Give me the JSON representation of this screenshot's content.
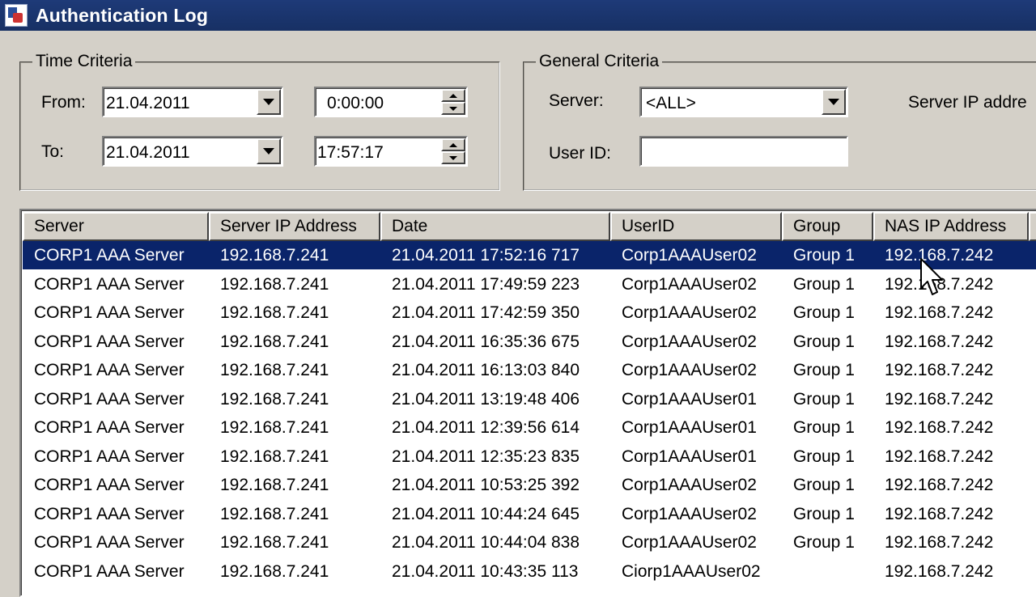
{
  "window": {
    "title": "Authentication Log"
  },
  "time_criteria": {
    "legend": "Time Criteria",
    "from_label": "From:",
    "from_date": "21.04.2011",
    "from_time": "0:00:00",
    "to_label": "To:",
    "to_date": "21.04.2011",
    "to_time": "17:57:17"
  },
  "general_criteria": {
    "legend": "General Criteria",
    "server_label": "Server:",
    "server_value": "<ALL>",
    "userid_label": "User ID:",
    "userid_value": "",
    "server_ip_label": "Server IP addre"
  },
  "table": {
    "columns": [
      "Server",
      "Server IP Address",
      "Date",
      "UserID",
      "Group",
      "NAS IP Address"
    ],
    "selected_row": 0,
    "rows": [
      [
        "CORP1 AAA Server",
        "192.168.7.241",
        "21.04.2011 17:52:16 717",
        "Corp1AAAUser02",
        "Group 1",
        "192.168.7.242"
      ],
      [
        "CORP1 AAA Server",
        "192.168.7.241",
        "21.04.2011 17:49:59 223",
        "Corp1AAAUser02",
        "Group 1",
        "192.168.7.242"
      ],
      [
        "CORP1 AAA Server",
        "192.168.7.241",
        "21.04.2011 17:42:59 350",
        "Corp1AAAUser02",
        "Group 1",
        "192.168.7.242"
      ],
      [
        "CORP1 AAA Server",
        "192.168.7.241",
        "21.04.2011 16:35:36 675",
        "Corp1AAAUser02",
        "Group 1",
        "192.168.7.242"
      ],
      [
        "CORP1 AAA Server",
        "192.168.7.241",
        "21.04.2011 16:13:03 840",
        "Corp1AAAUser02",
        "Group 1",
        "192.168.7.242"
      ],
      [
        "CORP1 AAA Server",
        "192.168.7.241",
        "21.04.2011 13:19:48 406",
        "Corp1AAAUser01",
        "Group 1",
        "192.168.7.242"
      ],
      [
        "CORP1 AAA Server",
        "192.168.7.241",
        "21.04.2011 12:39:56 614",
        "Corp1AAAUser01",
        "Group 1",
        "192.168.7.242"
      ],
      [
        "CORP1 AAA Server",
        "192.168.7.241",
        "21.04.2011 12:35:23 835",
        "Corp1AAAUser01",
        "Group 1",
        "192.168.7.242"
      ],
      [
        "CORP1 AAA Server",
        "192.168.7.241",
        "21.04.2011 10:53:25 392",
        "Corp1AAAUser02",
        "Group 1",
        "192.168.7.242"
      ],
      [
        "CORP1 AAA Server",
        "192.168.7.241",
        "21.04.2011 10:44:24 645",
        "Corp1AAAUser02",
        "Group 1",
        "192.168.7.242"
      ],
      [
        "CORP1 AAA Server",
        "192.168.7.241",
        "21.04.2011 10:44:04 838",
        "Corp1AAAUser02",
        "Group 1",
        "192.168.7.242"
      ],
      [
        "CORP1 AAA Server",
        "192.168.7.241",
        "21.04.2011 10:43:35 113",
        "Ciorp1AAAUser02",
        "",
        "192.168.7.242"
      ]
    ]
  },
  "colors": {
    "selection": "#0a246a",
    "titlebar": "#1e3a78",
    "face": "#d4d0c8"
  }
}
